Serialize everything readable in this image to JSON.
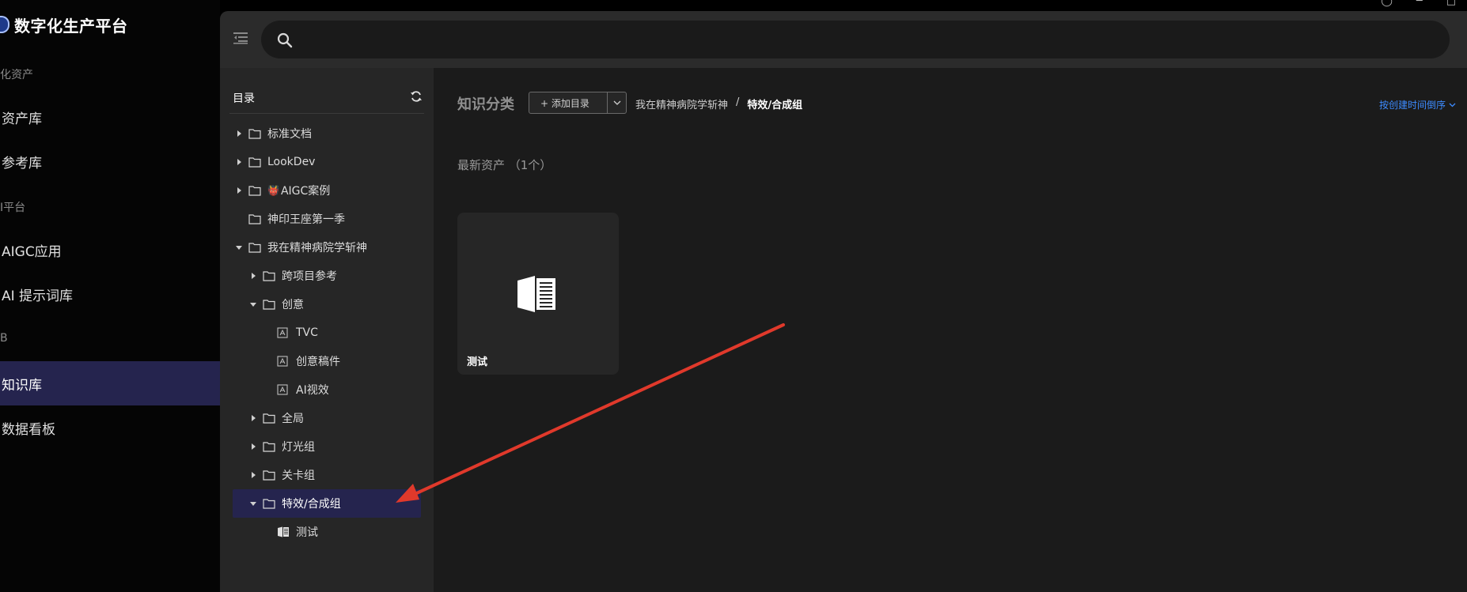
{
  "brand": {
    "title": "数字化生产平台"
  },
  "nav": {
    "groups": [
      "化资产",
      "I平台",
      "B"
    ],
    "items": [
      "资产库",
      "参考库",
      "AIGC应用",
      "AI 提示词库",
      "知识库",
      "数据看板"
    ],
    "active_index": 4
  },
  "search": {
    "placeholder": "",
    "value": ""
  },
  "tree": {
    "title": "目录",
    "rows": [
      {
        "label": "标准文档",
        "caret": "right",
        "icon": "folder-icon"
      },
      {
        "label": "LookDev",
        "caret": "right",
        "icon": "folder-icon"
      },
      {
        "label": "AIGC案例",
        "caret": "right",
        "icon": "folder-icon",
        "emoji": "👹"
      },
      {
        "label": "神印王座第一季",
        "caret": "none",
        "icon": "folder-icon"
      },
      {
        "label": "我在精神病院学斩神",
        "caret": "down",
        "icon": "folder-icon"
      },
      {
        "label": "跨项目参考",
        "caret": "right",
        "icon": "folder-icon"
      },
      {
        "label": "创意",
        "caret": "down",
        "icon": "folder-icon"
      },
      {
        "label": "TVC",
        "caret": "none",
        "icon": "doc-icon"
      },
      {
        "label": "创意稿件",
        "caret": "none",
        "icon": "doc-icon"
      },
      {
        "label": "AI视效",
        "caret": "none",
        "icon": "doc-icon"
      },
      {
        "label": "全局",
        "caret": "right",
        "icon": "folder-icon"
      },
      {
        "label": "灯光组",
        "caret": "right",
        "icon": "folder-icon"
      },
      {
        "label": "关卡组",
        "caret": "right",
        "icon": "folder-icon"
      },
      {
        "label": "特效/合成组",
        "caret": "down",
        "icon": "folder-icon",
        "selected": true
      },
      {
        "label": "测试",
        "caret": "none",
        "icon": "book-icon"
      }
    ]
  },
  "content": {
    "title": "知识分类",
    "add_button": "+ 添加目录",
    "breadcrumb": [
      "我在精神病院学斩神",
      "特效/合成组"
    ],
    "breadcrumb_sep": "/",
    "sort_label": "按创建时间倒序",
    "latest_label": "最新资产 （1个）",
    "assets": [
      {
        "label": "测试",
        "icon": "book-icon"
      }
    ]
  },
  "colors": {
    "active_bg": "#25244e",
    "accent_blue": "#3d8bff",
    "annotation_red": "#e0392b"
  }
}
